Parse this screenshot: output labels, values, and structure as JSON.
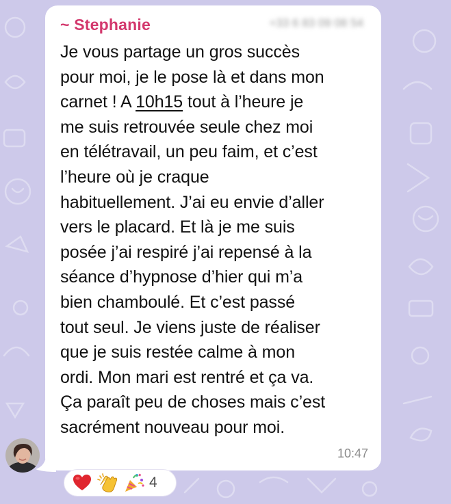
{
  "message": {
    "sender_name": "~ Stephanie",
    "phone": "+33 6 83 09 08 54",
    "lines": [
      "Je vous partage un gros succès",
      "pour moi, je le pose là et dans mon",
      "carnet ! A ",
      "me suis retrouvée seule chez moi",
      "en télétravail, un peu faim, et c’est",
      "l’heure où je craque",
      "habituellement. J’ai eu envie d’aller",
      "vers le placard. Et là je me suis",
      "posée j’ai respiré j’ai repensé à la",
      "séance d’hypnose d’hier qui m’a",
      "bien chamboulé. Et c’est passé",
      "tout seul. Je viens juste de réaliser",
      "que je suis restée calme à mon",
      "ordi. Mon mari est rentré et ça va.",
      "Ça paraît peu de choses mais c’est",
      "sacrément nouveau pour moi."
    ],
    "time_link": "10h15",
    "line3_tail": " tout à l’heure je",
    "timestamp": "10:47"
  },
  "reactions": {
    "icons": [
      "heart-icon",
      "clapping-hands-icon",
      "party-popper-icon"
    ],
    "count": "4"
  },
  "colors": {
    "sender": "#d3386d",
    "wallpaper": "#cdc9ea",
    "bubble": "#ffffff"
  }
}
